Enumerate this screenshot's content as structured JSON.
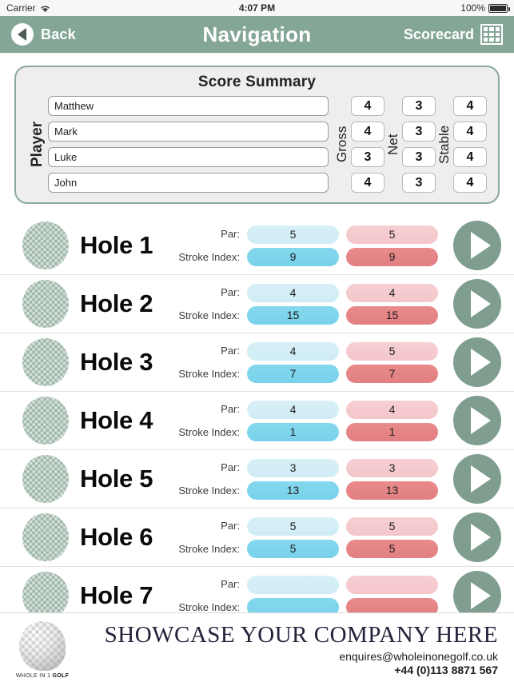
{
  "status_bar": {
    "carrier": "Carrier",
    "time": "4:07 PM",
    "battery": "100%"
  },
  "nav": {
    "back_label": "Back",
    "title": "Navigation",
    "scorecard_label": "Scorecard"
  },
  "summary": {
    "title": "Score Summary",
    "player_label": "Player",
    "gross_label": "Gross",
    "net_label": "Net",
    "stable_label": "Stable",
    "rows": [
      {
        "name": "Matthew",
        "gross": "4",
        "net": "3",
        "stable": "4"
      },
      {
        "name": "Mark",
        "gross": "4",
        "net": "3",
        "stable": "4"
      },
      {
        "name": "Luke",
        "gross": "3",
        "net": "3",
        "stable": "4"
      },
      {
        "name": "John",
        "gross": "4",
        "net": "3",
        "stable": "4"
      }
    ]
  },
  "holes": {
    "par_label": "Par:",
    "stroke_index_label": "Stroke Index:",
    "items": [
      {
        "name": "Hole 1",
        "par_blue": "5",
        "si_blue": "9",
        "par_red": "5",
        "si_red": "9"
      },
      {
        "name": "Hole 2",
        "par_blue": "4",
        "si_blue": "15",
        "par_red": "4",
        "si_red": "15"
      },
      {
        "name": "Hole 3",
        "par_blue": "4",
        "si_blue": "7",
        "par_red": "5",
        "si_red": "7"
      },
      {
        "name": "Hole 4",
        "par_blue": "4",
        "si_blue": "1",
        "par_red": "4",
        "si_red": "1"
      },
      {
        "name": "Hole 5",
        "par_blue": "3",
        "si_blue": "13",
        "par_red": "3",
        "si_red": "13"
      },
      {
        "name": "Hole 6",
        "par_blue": "5",
        "si_blue": "5",
        "par_red": "5",
        "si_red": "5"
      },
      {
        "name": "Hole 7",
        "par_blue": "",
        "si_blue": "",
        "par_red": "",
        "si_red": ""
      }
    ]
  },
  "footer": {
    "logo_text_1": "WHOLE IN 1 ",
    "logo_text_2": "GOLF",
    "headline": "SHOWCASE YOUR COMPANY HERE",
    "email": "enquires@wholeinonegolf.co.uk",
    "phone": "+44 (0)113 8871 567"
  },
  "colors": {
    "nav": "#84a696",
    "ball": "#9cb5a7",
    "blue": "#84d8ee",
    "red": "#e98a8b"
  }
}
